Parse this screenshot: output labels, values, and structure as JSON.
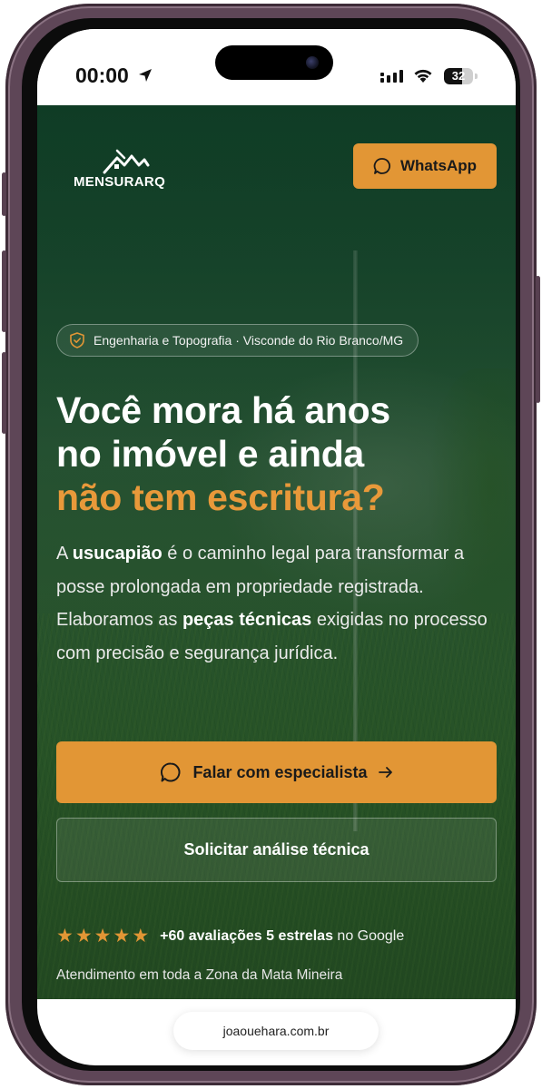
{
  "status_bar": {
    "time": "00:00",
    "battery": "32"
  },
  "header": {
    "logo_text": "MENSURARQ",
    "whatsapp_label": "WhatsApp"
  },
  "hero": {
    "badge_text": "Engenharia e Topografia · Visconde do Rio Branco/MG",
    "headline_line1": "Você mora há anos",
    "headline_line2": "no imóvel e ainda",
    "headline_accent": "não tem escritura?",
    "lead": {
      "p1": "A ",
      "b1": "usucapião",
      "p2": " é o caminho legal para transformar a posse prolongada em propriedade registrada. Elaboramos as ",
      "b2": "peças técnicas",
      "p3": " exigidas no processo com precisão e segurança jurídica."
    },
    "cta_primary_label": "Falar com especialista",
    "cta_secondary_label": "Solicitar análise técnica",
    "rating": {
      "stars": 5,
      "bold_text": "+60 avaliações 5 estrelas",
      "suffix": "no Google"
    },
    "service_area": "Atendimento em toda a Zona da Mata Mineira"
  },
  "browser": {
    "url": "joaouehara.com.br"
  },
  "colors": {
    "accent": "#e29635",
    "hero_green": "#1c4a30"
  },
  "icons": {
    "status": [
      "location-arrow-icon",
      "signal-icon",
      "wifi-icon",
      "battery-icon"
    ],
    "buttons": [
      "chat-bubble-icon",
      "arrow-right-icon"
    ],
    "badge": "shield-check-icon",
    "rating": "star-icon"
  }
}
